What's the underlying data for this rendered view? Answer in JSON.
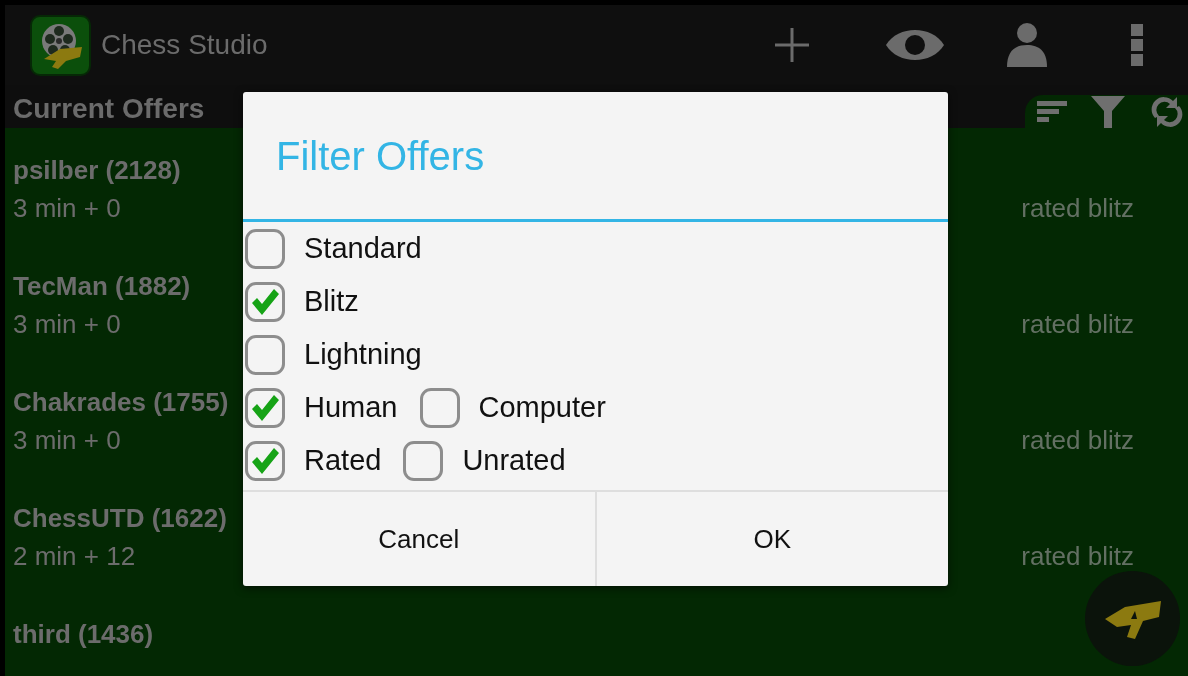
{
  "app_bar": {
    "title": "Chess Studio"
  },
  "section": {
    "title": "Current Offers"
  },
  "offers": [
    {
      "player": "psilber (2128)",
      "time_control": "3 min + 0",
      "type": "rated blitz"
    },
    {
      "player": "TecMan (1882)",
      "time_control": "3 min + 0",
      "type": "rated blitz"
    },
    {
      "player": "Chakrades (1755)",
      "time_control": "3 min + 0",
      "type": "rated blitz"
    },
    {
      "player": "ChessUTD (1622)",
      "time_control": "2 min + 12",
      "type": "rated blitz"
    },
    {
      "player": "third (1436)"
    }
  ],
  "dialog": {
    "title": "Filter Offers",
    "option_rows": [
      {
        "options": [
          {
            "label": "Standard",
            "checked": false
          }
        ]
      },
      {
        "options": [
          {
            "label": "Blitz",
            "checked": true
          }
        ]
      },
      {
        "options": [
          {
            "label": "Lightning",
            "checked": false
          }
        ]
      },
      {
        "options": [
          {
            "label": "Human",
            "checked": true
          },
          {
            "label": "Computer",
            "checked": false
          }
        ]
      },
      {
        "options": [
          {
            "label": "Rated",
            "checked": true
          },
          {
            "label": "Unrated",
            "checked": false
          }
        ]
      }
    ],
    "buttons": [
      "Cancel",
      "OK"
    ]
  }
}
